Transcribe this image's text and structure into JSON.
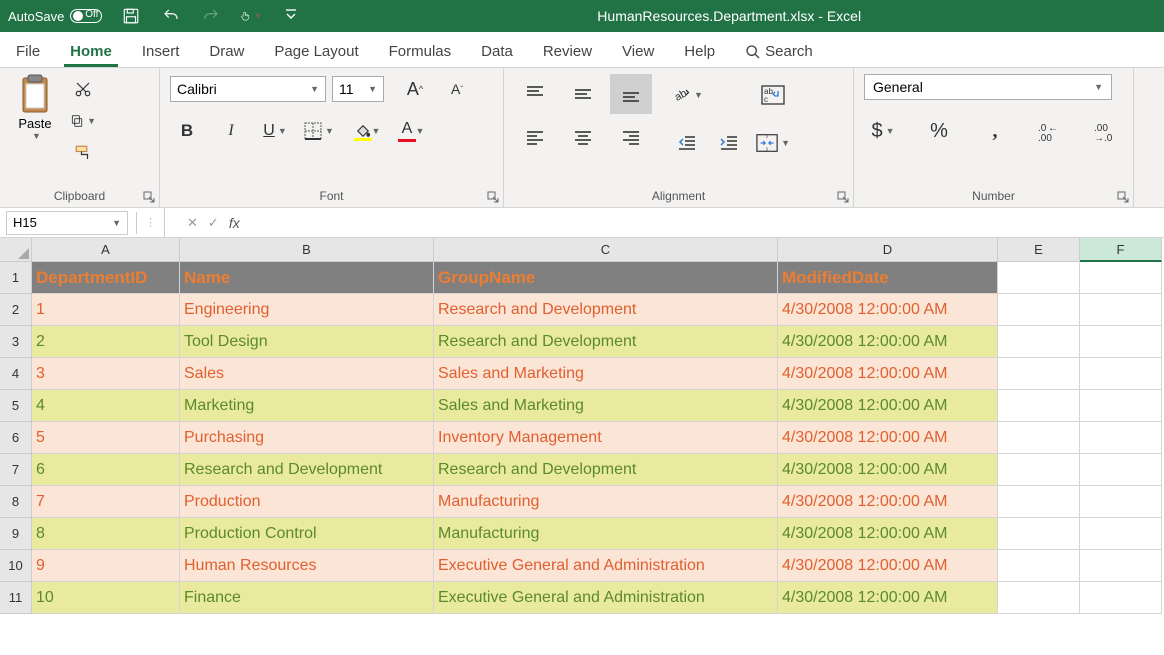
{
  "titlebar": {
    "autosave_label": "AutoSave",
    "autosave_state": "Off",
    "filename": "HumanResources.Department.xlsx  -  Excel"
  },
  "tabs": {
    "file": "File",
    "home": "Home",
    "insert": "Insert",
    "draw": "Draw",
    "page_layout": "Page Layout",
    "formulas": "Formulas",
    "data": "Data",
    "review": "Review",
    "view": "View",
    "help": "Help",
    "search": "Search"
  },
  "ribbon": {
    "clipboard": {
      "label": "Clipboard",
      "paste": "Paste"
    },
    "font": {
      "label": "Font",
      "name": "Calibri",
      "size": "11"
    },
    "alignment": {
      "label": "Alignment"
    },
    "number": {
      "label": "Number",
      "format": "General"
    }
  },
  "formula_bar": {
    "name_box": "H15",
    "fx": "fx",
    "formula": ""
  },
  "grid": {
    "columns": [
      "A",
      "B",
      "C",
      "D",
      "E",
      "F"
    ],
    "selected_col_index": 5,
    "headers": [
      "DepartmentID",
      "Name",
      "GroupName",
      "ModifiedDate"
    ],
    "rows": [
      {
        "id": "1",
        "name": "Engineering",
        "group": "Research and Development",
        "date": "4/30/2008 12:00:00 AM"
      },
      {
        "id": "2",
        "name": "Tool Design",
        "group": "Research and Development",
        "date": "4/30/2008 12:00:00 AM"
      },
      {
        "id": "3",
        "name": "Sales",
        "group": "Sales and Marketing",
        "date": "4/30/2008 12:00:00 AM"
      },
      {
        "id": "4",
        "name": "Marketing",
        "group": "Sales and Marketing",
        "date": "4/30/2008 12:00:00 AM"
      },
      {
        "id": "5",
        "name": "Purchasing",
        "group": "Inventory Management",
        "date": "4/30/2008 12:00:00 AM"
      },
      {
        "id": "6",
        "name": "Research and Development",
        "group": "Research and Development",
        "date": "4/30/2008 12:00:00 AM"
      },
      {
        "id": "7",
        "name": "Production",
        "group": "Manufacturing",
        "date": "4/30/2008 12:00:00 AM"
      },
      {
        "id": "8",
        "name": "Production Control",
        "group": "Manufacturing",
        "date": "4/30/2008 12:00:00 AM"
      },
      {
        "id": "9",
        "name": "Human Resources",
        "group": "Executive General and Administration",
        "date": "4/30/2008 12:00:00 AM"
      },
      {
        "id": "10",
        "name": "Finance",
        "group": "Executive General and Administration",
        "date": "4/30/2008 12:00:00 AM"
      }
    ]
  }
}
